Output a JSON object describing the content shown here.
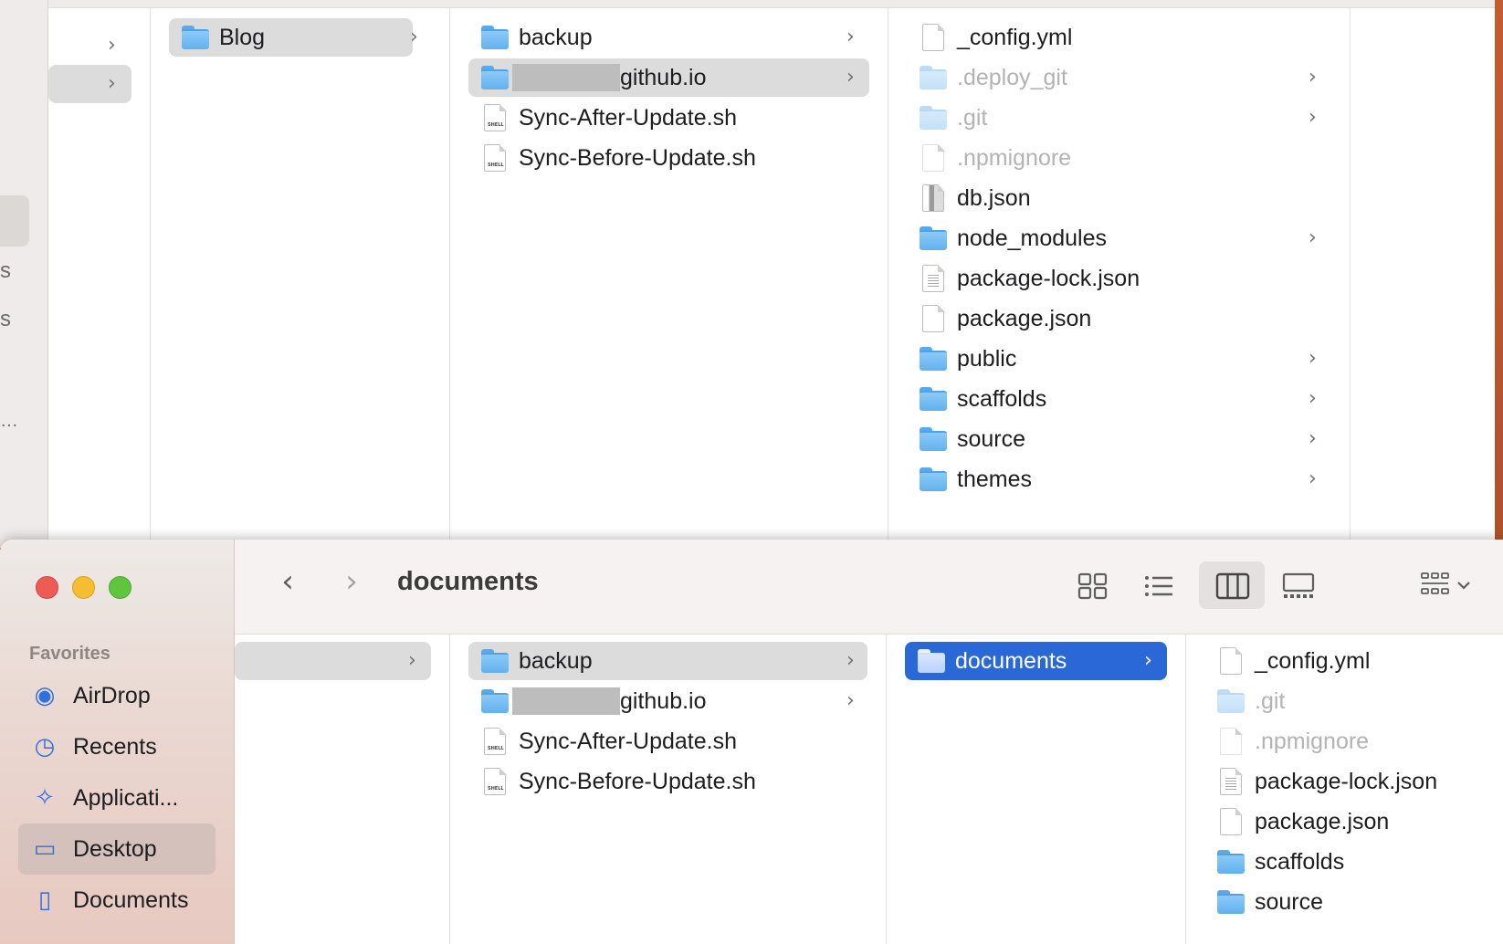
{
  "back_window": {
    "col_blog": {
      "items": [
        {
          "label": "Blog",
          "type": "folder",
          "selected": true,
          "has_children": true
        }
      ]
    },
    "col_blog_contents": {
      "items": [
        {
          "label": "backup",
          "type": "folder",
          "has_children": true
        },
        {
          "label": "github.io",
          "type": "folder",
          "selected": true,
          "redacted_prefix": true,
          "has_children": true
        },
        {
          "label": "Sync-After-Update.sh",
          "type": "shell"
        },
        {
          "label": "Sync-Before-Update.sh",
          "type": "shell"
        }
      ]
    },
    "col_repo_contents": {
      "items": [
        {
          "label": "_config.yml",
          "type": "doc"
        },
        {
          "label": ".deploy_git",
          "type": "folder",
          "hidden": true,
          "has_children": true
        },
        {
          "label": ".git",
          "type": "folder",
          "hidden": true,
          "has_children": true
        },
        {
          "label": ".npmignore",
          "type": "doc",
          "hidden": true
        },
        {
          "label": "db.json",
          "type": "db"
        },
        {
          "label": "node_modules",
          "type": "folder",
          "has_children": true
        },
        {
          "label": "package-lock.json",
          "type": "textdoc"
        },
        {
          "label": "package.json",
          "type": "doc"
        },
        {
          "label": "public",
          "type": "folder",
          "has_children": true
        },
        {
          "label": "scaffolds",
          "type": "folder",
          "has_children": true
        },
        {
          "label": "source",
          "type": "folder",
          "has_children": true
        },
        {
          "label": "themes",
          "type": "folder",
          "has_children": true
        }
      ]
    }
  },
  "front_window": {
    "title": "documents",
    "nav": {
      "back_icon": "chevron-left-icon",
      "forward_icon": "chevron-right-icon",
      "back_glyph": "‹",
      "forward_glyph": "›"
    },
    "view_modes": [
      "icon-view",
      "list-view",
      "column-view",
      "gallery-view"
    ],
    "active_view": "column-view",
    "sidebar": {
      "section_title": "Favorites",
      "items": [
        {
          "label": "AirDrop",
          "icon": "airdrop-icon",
          "glyph": "◉"
        },
        {
          "label": "Recents",
          "icon": "clock-icon",
          "glyph": "◷"
        },
        {
          "label": "Applicati...",
          "icon": "applications-icon",
          "glyph": "✧"
        },
        {
          "label": "Desktop",
          "icon": "desktop-icon",
          "glyph": "▭",
          "active": true
        },
        {
          "label": "Documents",
          "icon": "document-icon",
          "glyph": "▯"
        }
      ]
    },
    "col_blog_contents": {
      "items": [
        {
          "label": "backup",
          "type": "folder",
          "selected": true,
          "has_children": true
        },
        {
          "label": "github.io",
          "type": "folder",
          "redacted_prefix": true,
          "has_children": true
        },
        {
          "label": "Sync-After-Update.sh",
          "type": "shell"
        },
        {
          "label": "Sync-Before-Update.sh",
          "type": "shell"
        }
      ]
    },
    "col_backup": {
      "items": [
        {
          "label": "documents",
          "type": "folder",
          "selected": true,
          "has_children": true
        }
      ]
    },
    "col_documents": {
      "items": [
        {
          "label": "_config.yml",
          "type": "doc"
        },
        {
          "label": ".git",
          "type": "folder",
          "hidden": true
        },
        {
          "label": ".npmignore",
          "type": "doc",
          "hidden": true
        },
        {
          "label": "package-lock.json",
          "type": "textdoc"
        },
        {
          "label": "package.json",
          "type": "doc"
        },
        {
          "label": "scaffolds",
          "type": "folder"
        },
        {
          "label": "source",
          "type": "folder"
        }
      ]
    }
  }
}
